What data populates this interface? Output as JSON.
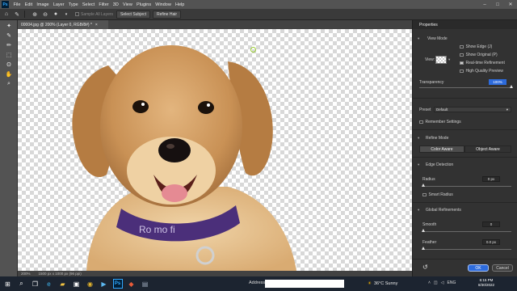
{
  "menubar": {
    "logo": "Ps",
    "items": [
      "File",
      "Edit",
      "Image",
      "Layer",
      "Type",
      "Select",
      "Filter",
      "3D",
      "View",
      "Plugins",
      "Window",
      "Help"
    ]
  },
  "options": {
    "sample_all_layers": "Sample All Layers",
    "select_subject": "Select Subject",
    "refine_hair": "Refine Hair"
  },
  "document": {
    "tab_title": "00004.jpg @ 200% (Layer 0, RGB/8#) *",
    "close_glyph": "×",
    "zoom_status": "200%",
    "size_status": "1500 px x 1000 px (96 ppi)"
  },
  "panel": {
    "title": "Properties",
    "view_mode_heading": "View Mode",
    "view_label": "View:",
    "show_edge": "Show Edge (J)",
    "show_original": "Show Original (P)",
    "realtime_refinement": "Real-time Refinement",
    "high_quality_preview": "High Quality Preview",
    "transparency_label": "Transparency",
    "transparency_value": "100%",
    "transparency_level": 1.0,
    "preset_label": "Preset",
    "preset_value": "Default",
    "remember_settings": "Remember Settings",
    "refine_mode_heading": "Refine Mode",
    "color_aware": "Color Aware",
    "object_aware": "Object Aware",
    "edge_detection_heading": "Edge Detection",
    "radius_label": "Radius",
    "radius_value": "0 px",
    "smart_radius": "Smart Radius",
    "global_refinements_heading": "Global Refinements",
    "smooth_label": "Smooth",
    "smooth_value": "0",
    "feather_label": "Feather",
    "feather_value": "0.0 px",
    "ok_label": "OK",
    "cancel_label": "Cancel"
  },
  "taskbar": {
    "address_label": "Address",
    "weather": "36°C  Sunny",
    "tray_lang": "ENG",
    "time": "6:15 PM",
    "date": "8/30/2022"
  },
  "colors": {
    "accent_blue": "#2d6bdc",
    "ui_dark": "#323232",
    "menu_gray": "#535353"
  }
}
